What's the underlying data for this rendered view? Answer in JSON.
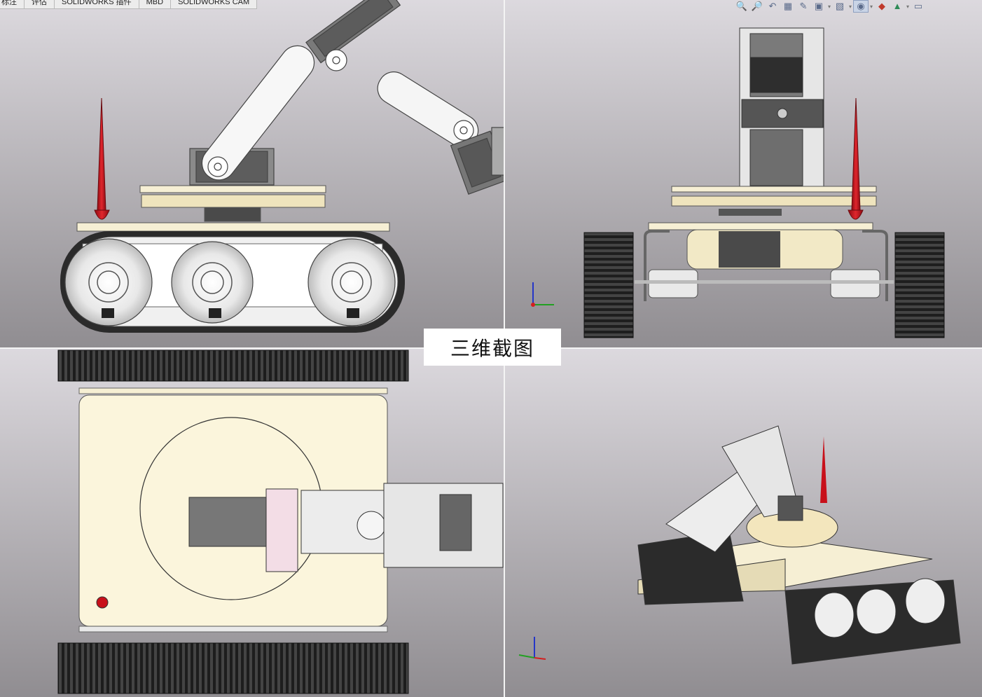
{
  "tabs": [
    {
      "label": "标注"
    },
    {
      "label": "评估"
    },
    {
      "label": "SOLIDWORKS 插件"
    },
    {
      "label": "MBD"
    },
    {
      "label": "SOLIDWORKS CAM"
    }
  ],
  "view_toolbar": {
    "icons": [
      "zoom-to-fit-icon",
      "zoom-area-icon",
      "previous-view-icon",
      "section-view-icon",
      "dynamic-annotation-icon",
      "view-orientation-icon",
      "display-style-icon",
      "hide-show-items-icon",
      "edit-appearance-icon",
      "apply-scene-icon",
      "view-settings-icon"
    ]
  },
  "caption": {
    "text": "三维截图"
  },
  "triad": {
    "x": "X",
    "y": "Y",
    "z": "Z"
  },
  "colors": {
    "viewport_top": "#d9d6dc",
    "viewport_bottom": "#8f8d90",
    "plate": "#f6efd4",
    "antenna": "#c8101a",
    "track": "#2a2a2a",
    "servo": "#6b6b6b",
    "triad_x": "#d21f1f",
    "triad_y": "#22a022",
    "triad_z": "#2536c8"
  }
}
